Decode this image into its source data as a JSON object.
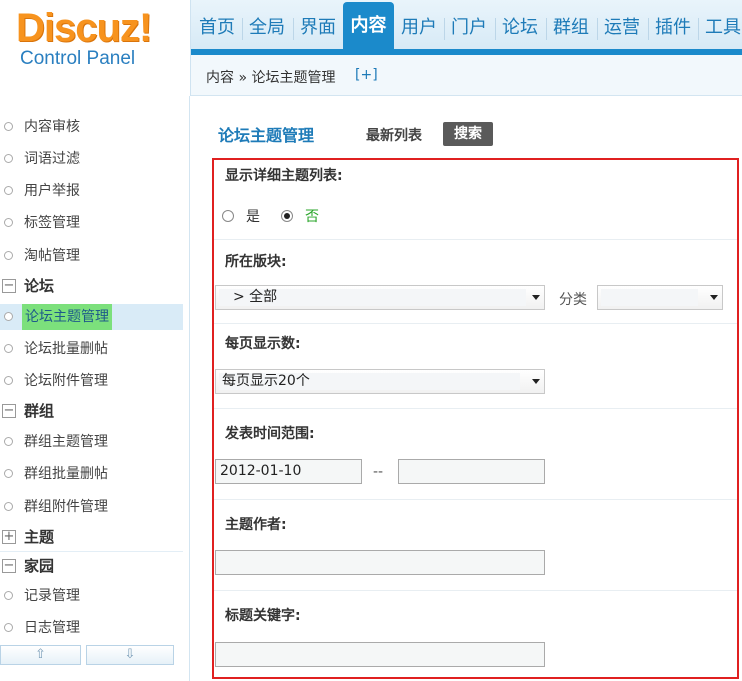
{
  "logo": {
    "brand": "Discuz",
    "exclaim": "!",
    "sub": "Control Panel"
  },
  "nav": {
    "tabs": [
      "首页",
      "全局",
      "界面",
      "内容",
      "用户",
      "门户",
      "论坛",
      "群组",
      "运营",
      "插件",
      "工具"
    ],
    "active": "内容"
  },
  "crumb": {
    "text": "内容 » 论坛主题管理",
    "plus": "[+]"
  },
  "sidebar": {
    "items_top": [
      "内容审核",
      "词语过滤",
      "用户举报",
      "标签管理",
      "淘帖管理"
    ],
    "group_forum": {
      "label": "论坛",
      "toggle": "−"
    },
    "items_forum": [
      "论坛主题管理",
      "论坛批量删帖",
      "论坛附件管理"
    ],
    "group_group": {
      "label": "群组",
      "toggle": "−"
    },
    "items_group": [
      "群组主题管理",
      "群组批量删帖",
      "群组附件管理"
    ],
    "group_theme": {
      "label": "主题",
      "toggle": "+"
    },
    "group_home": {
      "label": "家园",
      "toggle": "−"
    },
    "items_home": [
      "记录管理",
      "日志管理"
    ],
    "up_icon": "⇧",
    "down_icon": "⇩"
  },
  "main": {
    "title": "论坛主题管理",
    "tab_latest": "最新列表",
    "tab_search": "搜索",
    "detail": {
      "label": "显示详细主题列表:",
      "yes": "是",
      "no": "否",
      "selected": "否"
    },
    "forum": {
      "label": "所在版块:",
      "value": "> 全部",
      "category_label": "分类",
      "category_value": ""
    },
    "perpage": {
      "label": "每页显示数:",
      "value": "每页显示20个"
    },
    "time": {
      "label": "发表时间范围:",
      "from": "2012-01-10",
      "sep": "--",
      "to": ""
    },
    "author": {
      "label": "主题作者:",
      "value": ""
    },
    "keyword": {
      "label": "标题关键字:",
      "value": ""
    }
  },
  "colors": {
    "accent": "#1b8acb",
    "highlight": "#7ce07c",
    "frame": "#e02020",
    "logo": "#f7931e"
  }
}
